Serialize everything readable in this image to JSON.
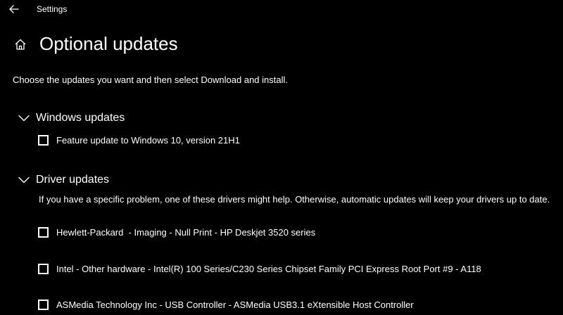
{
  "titlebar": {
    "title": "Settings",
    "back_icon": "back-arrow-icon"
  },
  "header": {
    "home_icon": "home-icon",
    "title": "Optional updates"
  },
  "intro": "Choose the updates you want and then select Download and install.",
  "windows_updates": {
    "header": "Windows updates",
    "expanded": true,
    "items": [
      {
        "label": "Feature update to Windows 10, version 21H1",
        "checked": false
      }
    ]
  },
  "driver_updates": {
    "header": "Driver updates",
    "expanded": true,
    "description": "If you have a specific problem, one of these drivers might help. Otherwise, automatic updates will keep your drivers up to date.",
    "items": [
      {
        "label": "Hewlett-Packard  - Imaging - Null Print - HP Deskjet 3520 series",
        "checked": false
      },
      {
        "label": "Intel - Other hardware - Intel(R) 100 Series/C230 Series Chipset Family PCI Express Root Port #9 - A118",
        "checked": false
      },
      {
        "label": "ASMedia Technology Inc - USB Controller - ASMedia USB3.1 eXtensible Host Controller",
        "checked": false
      }
    ]
  },
  "colors": {
    "background": "#000000",
    "text": "#ffffff"
  }
}
